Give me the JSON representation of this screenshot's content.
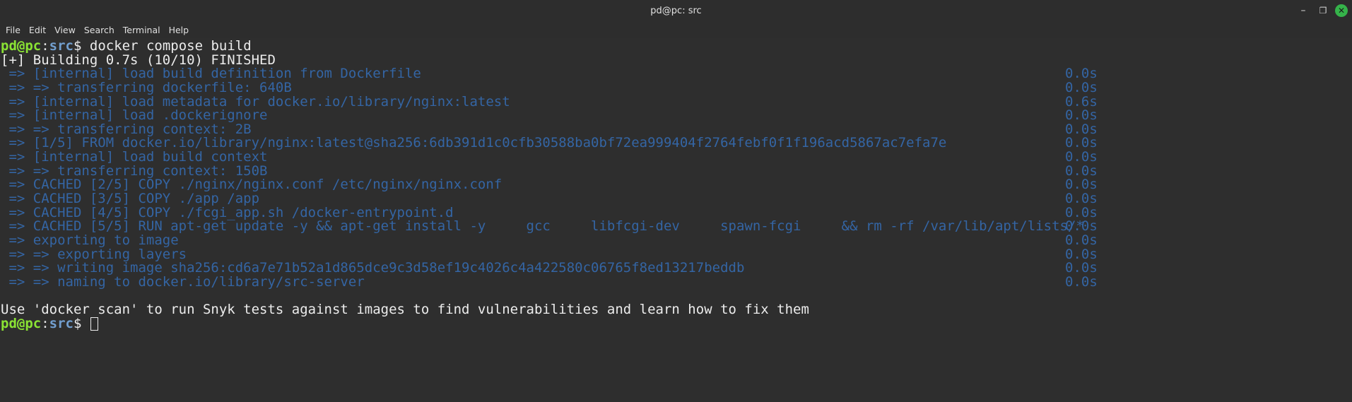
{
  "window": {
    "title": "pd@pc: src",
    "controls": [
      "minimize-icon",
      "maximize-icon",
      "close-icon"
    ]
  },
  "menubar": {
    "items": [
      "File",
      "Edit",
      "View",
      "Search",
      "Terminal",
      "Help"
    ]
  },
  "terminal": {
    "prompt": {
      "user": "pd@pc",
      "sep": ":",
      "dir": "src",
      "tail": "$ "
    },
    "command": "docker compose build",
    "status_line": "[+] Building 0.7s (10/10) FINISHED",
    "steps": [
      {
        "text": " => [internal] load build definition from Dockerfile",
        "time": "0.0s"
      },
      {
        "text": " => => transferring dockerfile: 640B",
        "time": "0.0s"
      },
      {
        "text": " => [internal] load metadata for docker.io/library/nginx:latest",
        "time": "0.6s"
      },
      {
        "text": " => [internal] load .dockerignore",
        "time": "0.0s"
      },
      {
        "text": " => => transferring context: 2B",
        "time": "0.0s"
      },
      {
        "text": " => [1/5] FROM docker.io/library/nginx:latest@sha256:6db391d1c0cfb30588ba0bf72ea999404f2764febf0f1f196acd5867ac7efa7e",
        "time": "0.0s"
      },
      {
        "text": " => [internal] load build context",
        "time": "0.0s"
      },
      {
        "text": " => => transferring context: 150B",
        "time": "0.0s"
      },
      {
        "text": " => CACHED [2/5] COPY ./nginx/nginx.conf /etc/nginx/nginx.conf",
        "time": "0.0s"
      },
      {
        "text": " => CACHED [3/5] COPY ./app /app",
        "time": "0.0s"
      },
      {
        "text": " => CACHED [4/5] COPY ./fcgi_app.sh /docker-entrypoint.d",
        "time": "0.0s"
      },
      {
        "text": " => CACHED [5/5] RUN apt-get update -y && apt-get install -y     gcc     libfcgi-dev     spawn-fcgi     && rm -rf /var/lib/apt/lists/*",
        "time": "0.0s"
      },
      {
        "text": " => exporting to image",
        "time": "0.0s"
      },
      {
        "text": " => => exporting layers",
        "time": "0.0s"
      },
      {
        "text": " => => writing image sha256:cd6a7e71b52a1d865dce9c3d58ef19c4026c4a422580c06765f8ed13217beddb",
        "time": "0.0s"
      },
      {
        "text": " => => naming to docker.io/library/src-server",
        "time": "0.0s"
      }
    ],
    "hint": "Use 'docker scan' to run Snyk tests against images to find vulnerabilities and learn how to fix them"
  },
  "colors": {
    "prompt_user": "#8ae234",
    "prompt_dir": "#729fcf",
    "step_text": "#3465a4",
    "foreground": "#ececec",
    "background": "#2e2e2e",
    "close_button": "#35b34a"
  }
}
